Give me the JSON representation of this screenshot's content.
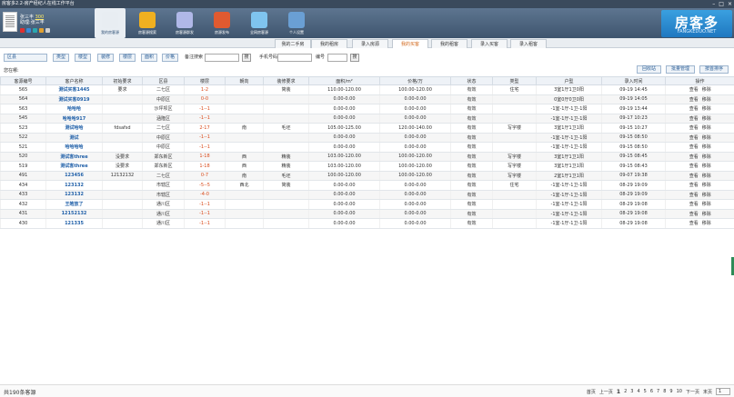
{
  "window": {
    "title": "房客多2.2-房产经纪人在线工作平台"
  },
  "user": {
    "name": "张三丰",
    "points": "300",
    "assistant_label": "助理:",
    "assistant": "张三丰"
  },
  "nav": [
    {
      "label": "我的房客源",
      "icon": "house-icon",
      "color": "#e8edf2",
      "active": true
    },
    {
      "label": "房客源搜索",
      "icon": "bee-icon",
      "color": "#f0b020"
    },
    {
      "label": "房客源群发",
      "icon": "rocket-icon",
      "color": "#b0b8e8"
    },
    {
      "label": "房源发布",
      "icon": "building-icon",
      "color": "#e05a30"
    },
    {
      "label": "全网房客源",
      "icon": "handshake-icon",
      "color": "#7fc4ef"
    },
    {
      "label": "个人设置",
      "icon": "person-icon",
      "color": "#6a9fd4"
    }
  ],
  "logo": {
    "text": "房客多",
    "sub": "FANGKEDUO.NET"
  },
  "tabs": [
    "我的二手房",
    "我的租房",
    "录入房源",
    "我的买客",
    "我的租客",
    "录入买客",
    "录入租客"
  ],
  "filters": {
    "buttons": [
      "区县",
      "类型",
      "楼型",
      "装修",
      "楼层",
      "面积",
      "价格"
    ],
    "note_label": "备注搜索",
    "phone_label": "手机号码",
    "code_label": "编号",
    "go": "搜"
  },
  "where": "您在哪:",
  "actions": [
    "回收站",
    "批量管理",
    "按首排序"
  ],
  "columns": [
    "客源编号",
    "客户名称",
    "初始要求",
    "区县",
    "楼层",
    "朝向",
    "装修要求",
    "面积/m²",
    "价格/万",
    "状态",
    "类型",
    "户型",
    "录入时间",
    "操作"
  ],
  "rows": [
    [
      "565",
      "测试买客1445",
      "要求",
      "二七区",
      "1-2",
      "",
      "简装",
      "110.00-120.00",
      "100.00-120.00",
      "有效",
      "住宅",
      "3室1厅1卫0阳",
      "09-19 14:45",
      "查看",
      "移除"
    ],
    [
      "564",
      "测试买客0919",
      "",
      "中原区",
      "0-0",
      "",
      "",
      "0.00-0.00",
      "0.00-0.00",
      "有效",
      "",
      "0室0厅0卫0阳",
      "09-19 14:05",
      "查看",
      "移除"
    ],
    [
      "563",
      "哈哈哈",
      "",
      "沙坪坝区",
      "-1--1",
      "",
      "",
      "0.00-0.00",
      "0.00-0.00",
      "有效",
      "",
      "-1室-1厅-1卫-1阳",
      "09-19 13:44",
      "查看",
      "移除"
    ],
    [
      "545",
      "哈哈哈917",
      "",
      "涵隆区",
      "-1--1",
      "",
      "",
      "0.00-0.00",
      "0.00-0.00",
      "有效",
      "",
      "-1室-1厅-1卫-1阳",
      "09-17 10:23",
      "查看",
      "移除"
    ],
    [
      "523",
      "测试哈哈",
      "fdsafsd",
      "二七区",
      "2-17",
      "南",
      "毛坯",
      "105.00-125.00",
      "120.00-140.00",
      "有效",
      "写字楼",
      "3室1厅1卫1阳",
      "09-15 10:27",
      "查看",
      "移除"
    ],
    [
      "522",
      "测试",
      "",
      "中原区",
      "-1--1",
      "",
      "",
      "0.00-0.00",
      "0.00-0.00",
      "有效",
      "",
      "-1室-1厅-1卫-1阳",
      "09-15 08:50",
      "查看",
      "移除"
    ],
    [
      "521",
      "哈哈哈哈",
      "",
      "中原区",
      "-1--1",
      "",
      "",
      "0.00-0.00",
      "0.00-0.00",
      "有效",
      "",
      "-1室-1厅-1卫-1阳",
      "09-15 08:50",
      "查看",
      "移除"
    ],
    [
      "520",
      "测试客three",
      "没要求",
      "郑东新区",
      "1-18",
      "西",
      "精装",
      "103.00-120.00",
      "100.00-120.00",
      "有效",
      "写字楼",
      "3室1厅1卫1阳",
      "09-15 08:45",
      "查看",
      "移除"
    ],
    [
      "519",
      "测试客three",
      "没要求",
      "郑东新区",
      "1-18",
      "西",
      "精装",
      "103.00-120.00",
      "100.00-120.00",
      "有效",
      "写字楼",
      "3室1厅1卫1阳",
      "09-15 08:43",
      "查看",
      "移除"
    ],
    [
      "491",
      "123456",
      "12132132",
      "二七区",
      "0-7",
      "南",
      "毛坯",
      "100.00-120.00",
      "100.00-120.00",
      "有效",
      "写字楼",
      "2室1厅1卫1阳",
      "09-07 19:38",
      "查看",
      "移除"
    ],
    [
      "434",
      "123132",
      "",
      "市辖区",
      "-5--5",
      "西北",
      "简装",
      "0.00-0.00",
      "0.00-0.00",
      "有效",
      "住宅",
      "-1室-1厅-1卫-1阳",
      "08-29 19:09",
      "查看",
      "移除"
    ],
    [
      "433",
      "123132",
      "",
      "市辖区",
      "-4-0",
      "",
      "",
      "0.00-0.00",
      "0.00-0.00",
      "有效",
      "",
      "-1室-1厅-1卫-1阳",
      "08-29 19:09",
      "查看",
      "移除"
    ],
    [
      "432",
      "王皓放了",
      "",
      "通川区",
      "-1--1",
      "",
      "",
      "0.00-0.00",
      "0.00-0.00",
      "有效",
      "",
      "-1室-1厅-1卫-1阳",
      "08-29 19:08",
      "查看",
      "移除"
    ],
    [
      "431",
      "12152132",
      "",
      "通川区",
      "-1--1",
      "",
      "",
      "0.00-0.00",
      "0.00-0.00",
      "有效",
      "",
      "-1室-1厅-1卫-1阳",
      "08-29 19:08",
      "查看",
      "移除"
    ],
    [
      "430",
      "121335",
      "",
      "通川区",
      "-1--1",
      "",
      "",
      "0.00-0.00",
      "0.00-0.00",
      "有效",
      "",
      "-1室-1厅-1卫-1阳",
      "08-29 19:08",
      "查看",
      "移除"
    ]
  ],
  "footer": {
    "total": "共190条客源",
    "first": "首页",
    "prev": "上一页",
    "pages": [
      "1",
      "2",
      "3",
      "4",
      "5",
      "6",
      "7",
      "8",
      "9",
      "10"
    ],
    "next": "下一页",
    "last": "末页",
    "page_select": "1"
  }
}
